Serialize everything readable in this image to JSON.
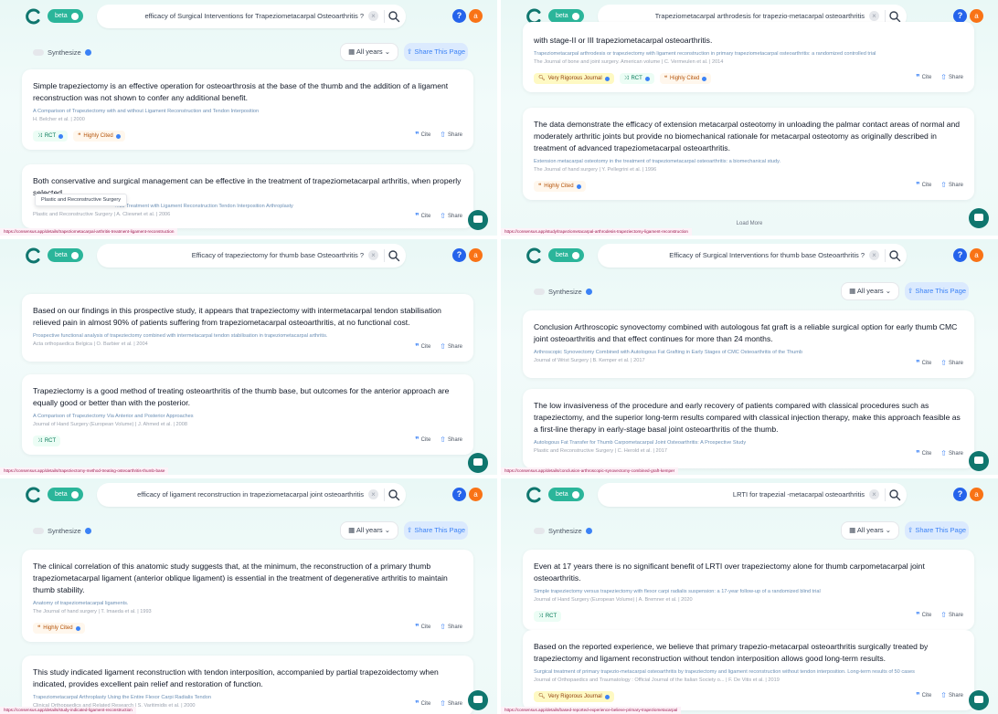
{
  "panels": [
    {
      "search": "efficacy of Surgical Interventions for Trapeziometacarpal Osteoarthritis ?",
      "toolbar": {
        "synthesize": "Synthesize",
        "years": "All years",
        "share": "Share This Page"
      },
      "cards": [
        {
          "claim": "Simple trapeziectomy is an effective operation for osteoarthrosis at the base of the thumb and the addition of a ligament reconstruction was not shown to confer any additional benefit.",
          "title": "A Comparison of Trapeziectomy with and without Ligament Reconstruction and Tendon Interposition",
          "meta": "H. Belcher et al.  |  2000",
          "badges": [
            {
              "label": "RCT",
              "kind": "rct"
            },
            {
              "label": "Highly Cited",
              "kind": "cited"
            }
          ],
          "cite": "Cite",
          "share": "Share"
        },
        {
          "claim": "Both conservative and surgical management can be effective in the treatment of trapeziometacarpal arthritis, when properly selected.",
          "title": "...tic Treatment with Ligament Reconstruction Tendon Interposition Arthroplasty",
          "meta": "Plastic and Reconstructive Surgery  |  A. Cliewnet et al.  |  2006",
          "badges": [],
          "cite": "Cite",
          "share": "Share"
        }
      ],
      "tooltip": "Plastic and Reconstructive Surgery",
      "url": "https://consensus.app/details/trapeziometacarpal-arthritis-treatment-ligament-reconstruction"
    },
    {
      "search": "Trapeziometacarpal arthrodesis for trapezio-metacarpal osteoarthritis",
      "cards": [
        {
          "claim": "with stage-II or III trapeziometacarpal osteoarthritis.",
          "title": "Trapeziometacarpal arthrodesis or trapeziectomy with ligament reconstruction in primary trapeziometacarpal osteoarthritis: a randomized controlled trial",
          "meta": "The Journal of bone and joint surgery. American volume  |  C. Vermeulen et al.  |  2014",
          "badges": [
            {
              "label": "Very Rigorous Journal",
              "kind": "rig"
            },
            {
              "label": "RCT",
              "kind": "rct"
            },
            {
              "label": "Highly Cited",
              "kind": "cited"
            }
          ],
          "cite": "Cite",
          "share": "Share"
        },
        {
          "claim": "The data demonstrate the efficacy of extension metacarpal osteotomy in unloading the palmar contact areas of normal and moderately arthritic joints but provide no biomechanical rationale for metacarpal osteotomy as originally described in treatment of advanced trapeziometacarpal osteoarthritis.",
          "title": "Extension metacarpal osteotomy in the treatment of trapeziometacarpal osteoarthritis: a biomechanical study.",
          "meta": "The Journal of hand surgery  |  Y. Pellegrini et al.  |  1996",
          "badges": [
            {
              "label": "Highly Cited",
              "kind": "cited"
            }
          ],
          "cite": "Cite",
          "share": "Share"
        }
      ],
      "load_more": "Load More",
      "url": "https://consensus.app/study/trapeziometacarpal-arthrodesis-trapeziectomy-ligament-reconstruction"
    },
    {
      "search": "Efficacy of trapeziectomy for thumb base Osteoarthritis ?",
      "cards": [
        {
          "claim": "Based on our findings in this prospective study, it appears that trapeziectomy with intermetacarpal tendon stabilisation relieved pain in almost 90% of patients suffering from trapeziometacarpal osteoarthritis, at no functional cost.",
          "title": "Prospective functional analysis of trapeziectomy combined with intermetacarpal tendon stabilisation in trapeziometacarpal arthritis.",
          "meta": "Acta orthopaedica Belgica  |  O. Barbier et al.  |  2004",
          "badges": [],
          "cite": "Cite",
          "share": "Share"
        },
        {
          "claim": "Trapeziectomy is a good method of treating osteoarthritis of the thumb base, but outcomes for the anterior approach are equally good or better than with the posterior.",
          "title": "A Comparison of Trapeziectomy Via Anterior and Posterior Approaches",
          "meta": "Journal of Hand Surgery (European Volume)  |  J. Ahmed et al.  |  2008",
          "badges": [
            {
              "label": "RCT",
              "kind": "rct"
            }
          ],
          "cite": "Cite",
          "share": "Share"
        }
      ],
      "url": "https://consensus.app/details/trapeziectomy-method-treating-osteoarthritis-thumb-base"
    },
    {
      "search": "Efficacy of Surgical Interventions for thumb base Osteoarthritis ?",
      "toolbar": {
        "synthesize": "Synthesize",
        "years": "All years",
        "share": "Share This Page"
      },
      "cards": [
        {
          "claim": "Conclusion Arthroscopic synovectomy combined with autologous fat graft is a reliable surgical option for early thumb CMC joint osteoarthritis and that effect continues for more than 24 months.",
          "title": "Arthroscopic Synovectomy Combined with Autologous Fat Grafting in Early Stages of CMC Osteoarthritis of the Thumb",
          "meta": "Journal of Wrist Surgery  |  B. Kemper et al.  |  2017",
          "badges": [],
          "cite": "Cite",
          "share": "Share"
        },
        {
          "claim": "The low invasiveness of the procedure and early recovery of patients compared with classical procedures such as trapeziectomy, and the superior long-term results compared with classical injection therapy, make this approach feasible as a first-line therapy in early-stage basal joint osteoarthritis of the thumb.",
          "title": "Autologous Fat Transfer for Thumb Carpometacarpal Joint Osteoarthritis: A Prospective Study",
          "meta": "Plastic and Reconstructive Surgery  |  C. Herold et al.  |  2017",
          "badges": [],
          "cite": "Cite",
          "share": "Share"
        }
      ],
      "url": "https://consensus.app/details/conclusion-arthroscopic-synovectomy-combined-graft-kemper"
    },
    {
      "search": "efficacy of ligament reconstruction in trapeziometacarpal joint osteoarthritis",
      "toolbar": {
        "synthesize": "Synthesize",
        "years": "All years",
        "share": "Share This Page"
      },
      "cards": [
        {
          "claim": "The clinical correlation of this anatomic study suggests that, at the minimum, the reconstruction of a primary thumb trapeziometacarpal ligament (anterior oblique ligament) is essential in the treatment of degenerative arthritis to maintain thumb stability.",
          "title": "Anatomy of trapeziometacarpal ligaments.",
          "meta": "The Journal of hand surgery  |  T. Imaeda et al.  |  1993",
          "badges": [
            {
              "label": "Highly Cited",
              "kind": "cited"
            }
          ],
          "cite": "Cite",
          "share": "Share"
        },
        {
          "claim": "This study indicated ligament reconstruction with tendon interposition, accompanied by partial trapezoidectomy when indicated, provides excellent pain relief and restoration of function.",
          "title": "Trapeziometacarpal Arthroplasty Using the Entire Flexor Carpi Radialis Tendon",
          "meta": "Clinical Orthopaedics and Related Research  |  S. Varitimidis et al.  |  2000",
          "badges": [],
          "cite": "Cite",
          "share": "Share"
        }
      ],
      "url": "https://consensus.app/details/study-indicated-ligament-reconstruction"
    },
    {
      "search": "LRTI for trapezial -metacarpal osteoarthritis",
      "toolbar": {
        "synthesize": "Synthesize",
        "years": "All years",
        "share": "Share This Page"
      },
      "cards": [
        {
          "claim": "Even at 17 years there is no significant benefit of LRTI over trapeziectomy alone for thumb carpometacarpal joint osteoarthritis.",
          "title": "Simple trapeziectomy versus trapeziectomy with flexor carpi radialis suspension: a 17-year follow-up of a randomized blind trial",
          "meta": "Journal of Hand Surgery (European Volume)  |  A. Bremner et al.  |  2020",
          "badges": [
            {
              "label": "RCT",
              "kind": "rct"
            }
          ],
          "cite": "Cite",
          "share": "Share"
        },
        {
          "claim": "Based on the reported experience, we believe that primary trapezio-metacarpal osteoarthritis surgically treated by trapeziectomy and ligament reconstruction without tendon interposition allows good long-term results.",
          "title": "Surgical treatment of primary trapezio-metacarpal osteoarthritis by trapeziectomy and ligament reconstruction without tendon interposition. Long-term results of 50 cases",
          "meta": "Journal of Orthopaedics and Traumatology : Official Journal of the Italian Society o...  |  F. De Vitis et al.  |  2019",
          "badges": [
            {
              "label": "Very Rigorous Journal",
              "kind": "rig"
            }
          ],
          "cite": "Cite",
          "share": "Share"
        }
      ],
      "url": "https://consensus.app/details/based-reported-experience-believe-primary-trapeziometacarpal"
    }
  ],
  "header": {
    "beta": "beta",
    "help": "?",
    "avatar": "a"
  },
  "colors": {
    "accent": "#2bb59a",
    "link": "#3b82f6",
    "chat": "#0f766e",
    "avatar": "#f97316"
  }
}
